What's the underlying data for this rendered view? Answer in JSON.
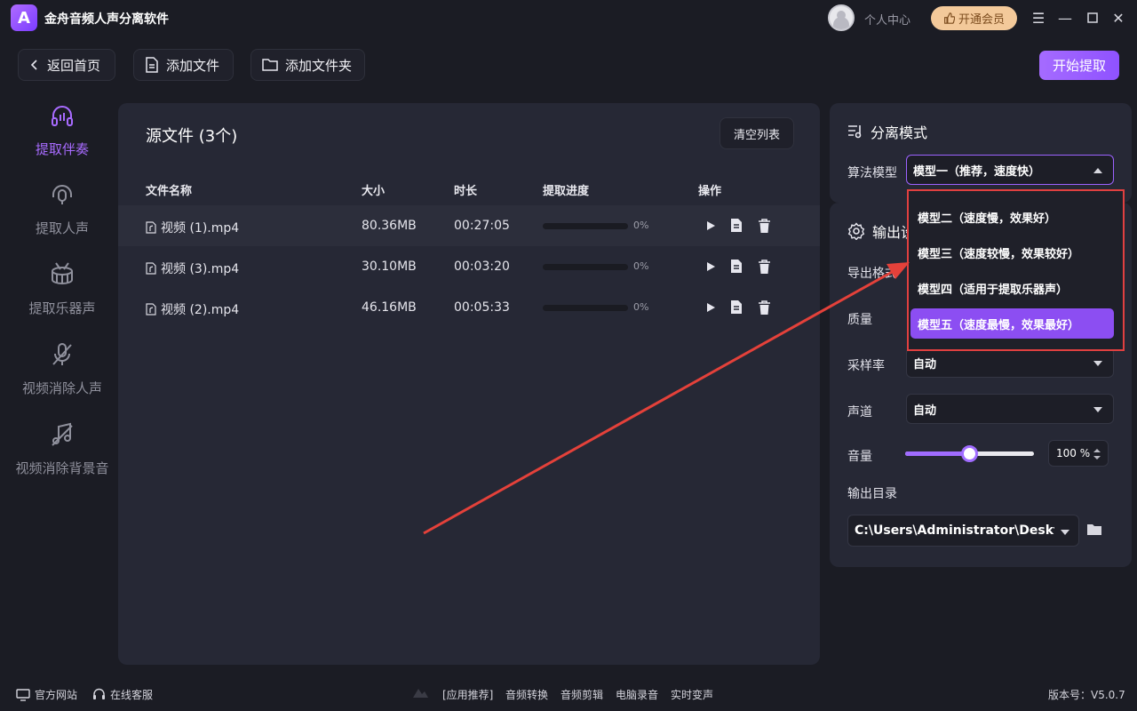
{
  "app": {
    "title": "金舟音频人声分离软件",
    "logo_letter": "A",
    "user_center": "个人中心",
    "vip_label": "开通会员"
  },
  "toolbar": {
    "back": "返回首页",
    "add_file": "添加文件",
    "add_folder": "添加文件夹",
    "start": "开始提取"
  },
  "nav": [
    {
      "label": "提取伴奏",
      "icon": "headphones-icon",
      "active": true
    },
    {
      "label": "提取人声",
      "icon": "microphone-headset-icon",
      "active": false
    },
    {
      "label": "提取乐器声",
      "icon": "drum-icon",
      "active": false
    },
    {
      "label": "视频消除人声",
      "icon": "mic-off-icon",
      "active": false
    },
    {
      "label": "视频消除背景音",
      "icon": "music-off-icon",
      "active": false
    }
  ],
  "files": {
    "title": "源文件 (3个)",
    "clear_label": "清空列表",
    "headers": {
      "name": "文件名称",
      "size": "大小",
      "duration": "时长",
      "progress": "提取进度",
      "actions": "操作"
    },
    "rows": [
      {
        "name": "视频 (1).mp4",
        "size": "80.36MB",
        "duration": "00:27:05",
        "progress": "0%"
      },
      {
        "name": "视频 (3).mp4",
        "size": "30.10MB",
        "duration": "00:03:20",
        "progress": "0%"
      },
      {
        "name": "视频 (2).mp4",
        "size": "46.16MB",
        "duration": "00:05:33",
        "progress": "0%"
      }
    ]
  },
  "separation": {
    "title": "分离模式",
    "model_label": "算法模型",
    "model_value": "模型一（推荐，速度快）",
    "options": [
      "模型二（速度慢，效果好）",
      "模型三（速度较慢，效果较好）",
      "模型四（适用于提取乐器声）",
      "模型五（速度最慢，效果最好）"
    ],
    "selected_option_index": 3
  },
  "output": {
    "title": "输出设",
    "format_label": "导出格式",
    "quality_label": "质量",
    "sample_label": "采样率",
    "sample_value": "自动",
    "channel_label": "声道",
    "channel_value": "自动",
    "volume_label": "音量",
    "volume_value": "100 %",
    "volume_level": 0.5,
    "dir_label": "输出目录",
    "dir_value": "C:\\Users\\Administrator\\Desktop"
  },
  "footer": {
    "website": "官方网站",
    "support": "在线客服",
    "recommend": "[应用推荐]",
    "links": [
      "音频转换",
      "音频剪辑",
      "电脑录音",
      "实时变声"
    ],
    "version": "版本号：V5.0.7"
  },
  "colors": {
    "accent": "#a06cff",
    "highlight_border": "#e04040",
    "panel": "#262835",
    "background": "#1b1c24"
  }
}
